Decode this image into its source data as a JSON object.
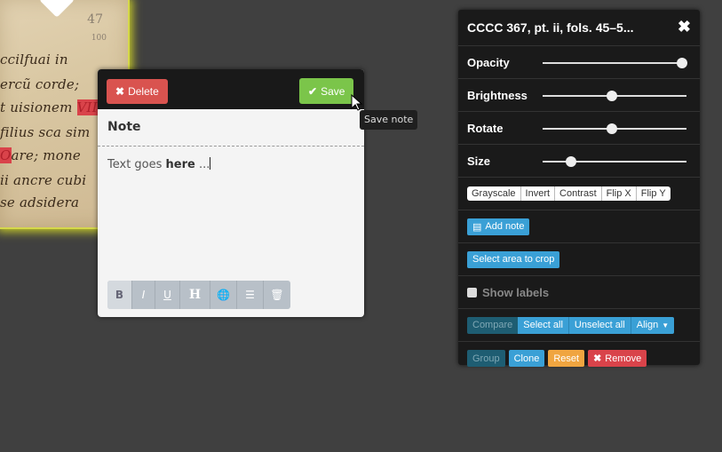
{
  "manuscript": {
    "folio_number": "47",
    "folio_small": "100",
    "lines": [
      "ccilfuai in",
      "ercũ corde;",
      "t uisionem",
      "filius sca sim",
      "are; mone",
      "ii ancre cubi",
      "se adsidera"
    ],
    "red_marks": [
      "VII",
      "O"
    ]
  },
  "note": {
    "delete_label": "Delete",
    "save_label": "Save",
    "title": "Note",
    "body_prefix": "Text goes ",
    "body_bold": "here",
    "body_suffix": " ..."
  },
  "tooltip": {
    "text": "Save note"
  },
  "panel": {
    "title": "CCCC 367, pt. ii, fols. 45–5...",
    "sliders": [
      {
        "label": "Opacity",
        "value": 0.97
      },
      {
        "label": "Brightness",
        "value": 0.48
      },
      {
        "label": "Rotate",
        "value": 0.48
      },
      {
        "label": "Size",
        "value": 0.2
      }
    ],
    "filters": [
      "Grayscale",
      "Invert",
      "Contrast",
      "Flip X",
      "Flip Y"
    ],
    "add_note": "Add note",
    "crop": "Select area to crop",
    "show_labels": "Show labels",
    "compare": "Compare",
    "select_all": "Select all",
    "unselect_all": "Unselect all",
    "align": "Align",
    "group": "Group",
    "clone": "Clone",
    "reset": "Reset",
    "remove": "Remove"
  }
}
